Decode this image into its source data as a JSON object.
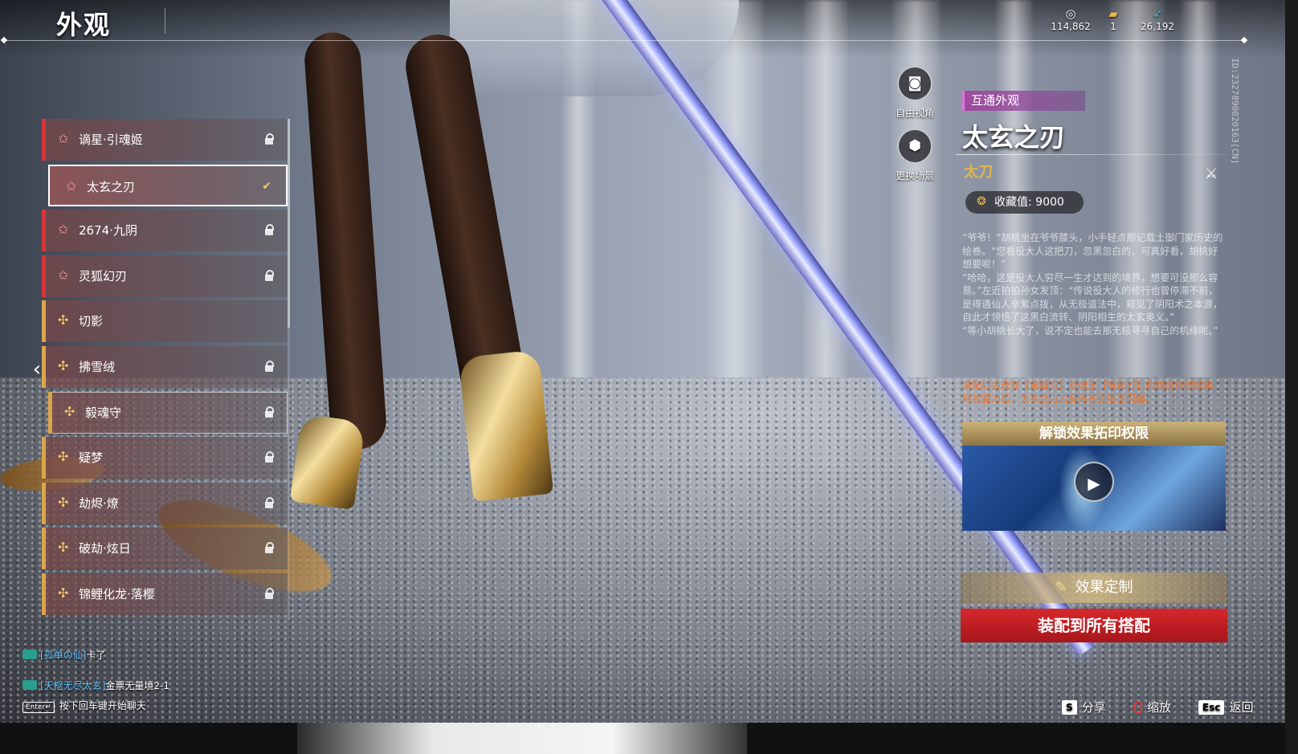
{
  "header": {
    "title": "外观",
    "currencies": [
      {
        "icon": "coin-icon",
        "value": "114,862"
      },
      {
        "icon": "ticket-icon",
        "value": "1"
      },
      {
        "icon": "feather-icon",
        "value": "26,192"
      }
    ]
  },
  "side_id": "ID:2327890020163[CN]",
  "skin_list": {
    "items": [
      {
        "name": "谪星·引魂姬",
        "rarity": "red",
        "status": "locked"
      },
      {
        "name": "太玄之刃",
        "rarity": "red",
        "status": "equipped"
      },
      {
        "name": "2674·九阴",
        "rarity": "red",
        "status": "locked"
      },
      {
        "name": "灵狐幻刃",
        "rarity": "red",
        "status": "locked"
      },
      {
        "name": "切影",
        "rarity": "gold",
        "status": "owned"
      },
      {
        "name": "拂雪绒",
        "rarity": "gold",
        "status": "locked"
      },
      {
        "name": "毅魂守",
        "rarity": "gold",
        "status": "locked"
      },
      {
        "name": "疑梦",
        "rarity": "gold",
        "status": "locked"
      },
      {
        "name": "劫烬·燎",
        "rarity": "gold",
        "status": "locked"
      },
      {
        "name": "破劫·炫日",
        "rarity": "gold",
        "status": "locked"
      },
      {
        "name": "锦鲤化龙·落樱",
        "rarity": "gold",
        "status": "locked"
      }
    ],
    "colors": {
      "red": "#d8343a",
      "gold": "#d9a64a"
    }
  },
  "chat": {
    "lines": [
      {
        "user": "[孤单の仙]",
        "msg": "卡了"
      },
      {
        "user": "[天枢无尽太玄]",
        "msg": "金票无量境2-1"
      }
    ],
    "enter_key": "Enter↵",
    "hint": "按下回车键开始聊天"
  },
  "camera": {
    "free_view": "自由视角",
    "change_scene": "更换场景"
  },
  "detail": {
    "shared_tag": "互通外观",
    "title": "太玄之刃",
    "weapon_type": "太刀",
    "collect_label": "收藏值: 9000",
    "lore": [
      "“爷爷！”胡桃坐在爷爷膝头，小手轻点那记载土御门家历史的绘卷。“您看役大人这把刀，忽黑忽白的，可真好看，胡桃好想要呢！”",
      "“哈哈，这是役大人穷尽一生才达到的境界，想要可没那么容易。”左近拍拍孙女发顶：“传说役大人的修行也曾停滞不前，是得遇仙人辛紫点拨，从无极道法中，窥见了阴阳术之本源，自此才领悟了这黑白流转、阴阳相生的太玄奥义。”",
      "“等小胡桃长大了，说不定也能去那无极寻寻自己的机缘呢。”"
    ],
    "effect_note": [
      "装配后会改变【苗疆刀】及魂玉【斩影刃】的攻击特效效果。",
      "释放蓄力后，太玄之刃刀身光芒会随之闪耀。"
    ],
    "unlock_title": "解锁效果拓印权限",
    "custom_label": "效果定制",
    "equip_label": "装配到所有搭配"
  },
  "hotkeys": [
    {
      "key": "S",
      "label": "分享"
    },
    {
      "key": "",
      "label": "缩放"
    },
    {
      "key": "Esc",
      "label": "返回"
    }
  ]
}
